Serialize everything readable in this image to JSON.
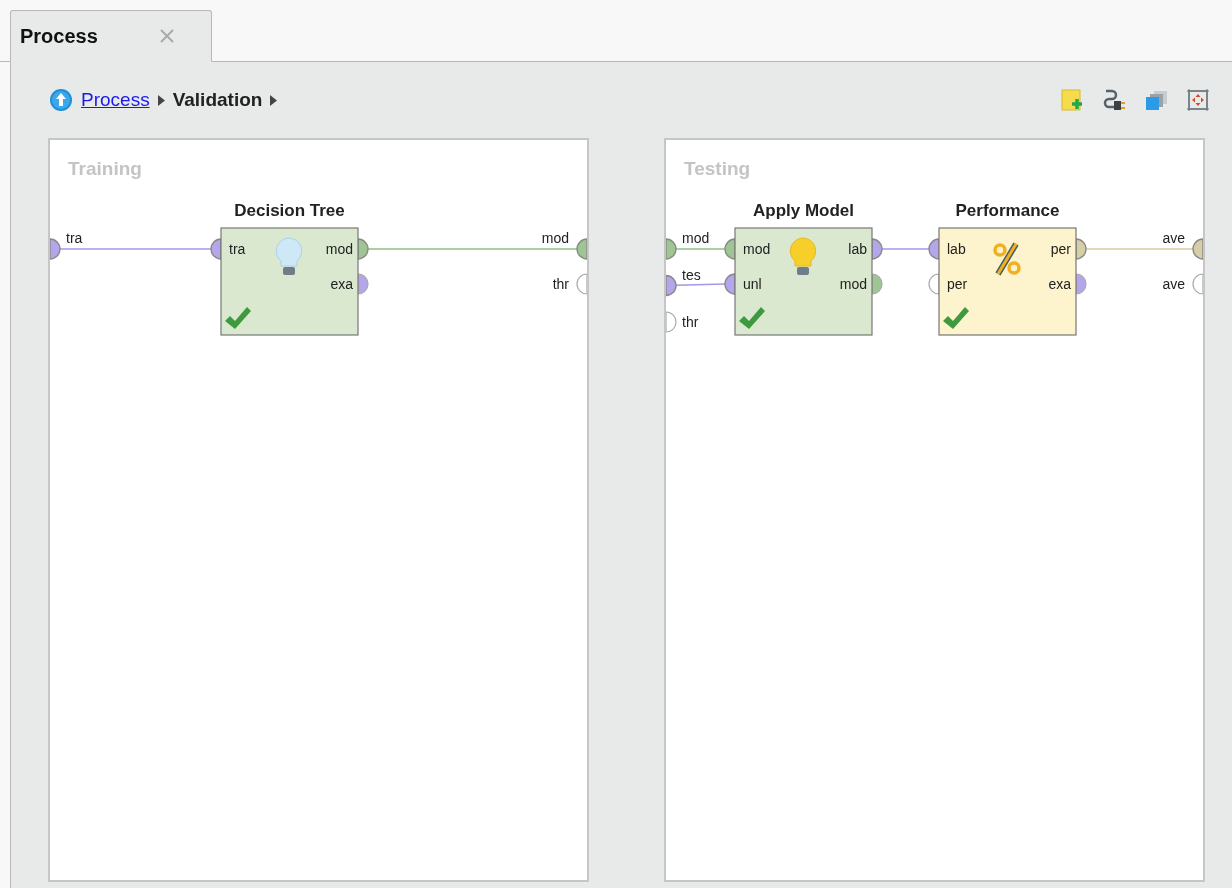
{
  "tab": {
    "label": "Process",
    "selected": true
  },
  "breadcrumb": [
    {
      "label": "Process",
      "kind": "link"
    },
    {
      "label": "Validation",
      "kind": "current"
    }
  ],
  "panels": [
    {
      "title": "Training",
      "inputs": [
        {
          "label": "tra",
          "color": "#b5a6ec",
          "connected": true
        }
      ],
      "outputs": [
        {
          "label": "mod",
          "color": "#9fc592",
          "connected": true
        },
        {
          "label": "thr",
          "color": "#ffffff",
          "connected": false
        }
      ],
      "operators": [
        {
          "name": "Decision Tree",
          "kind": "learner",
          "color": "#d9e8cf",
          "valid": true,
          "inputs": [
            {
              "label": "tra",
              "color": "#b5a6ec",
              "connected": true
            }
          ],
          "outputs": [
            {
              "label": "mod",
              "color": "#9fc592",
              "connected": true
            },
            {
              "label": "exa",
              "color": "#b5a6ec",
              "connected": false
            }
          ]
        }
      ]
    },
    {
      "title": "Testing",
      "inputs": [
        {
          "label": "mod",
          "color": "#9fc592",
          "connected": true
        },
        {
          "label": "tes",
          "color": "#b5a6ec",
          "connected": true
        },
        {
          "label": "thr",
          "color": "#ffffff",
          "connected": false
        }
      ],
      "outputs": [
        {
          "label": "ave",
          "color": "#d6cfa6",
          "connected": true
        },
        {
          "label": "ave",
          "color": "#ffffff",
          "connected": false
        }
      ],
      "operators": [
        {
          "name": "Apply Model",
          "kind": "applier",
          "color": "#d9e8cf",
          "valid": true,
          "inputs": [
            {
              "label": "mod",
              "color": "#9fc592",
              "connected": true
            },
            {
              "label": "unl",
              "color": "#b5a6ec",
              "connected": true
            }
          ],
          "outputs": [
            {
              "label": "lab",
              "color": "#b5a6ec",
              "connected": true
            },
            {
              "label": "mod",
              "color": "#9fc592",
              "connected": false
            }
          ]
        },
        {
          "name": "Performance",
          "kind": "performance",
          "color": "#fdf3cc",
          "valid": true,
          "inputs": [
            {
              "label": "lab",
              "color": "#b5a6ec",
              "connected": true
            },
            {
              "label": "per",
              "color": "#ffffff",
              "connected": false
            }
          ],
          "outputs": [
            {
              "label": "per",
              "color": "#d6cfa6",
              "connected": true
            },
            {
              "label": "exa",
              "color": "#b5a6ec",
              "connected": false
            }
          ]
        }
      ]
    }
  ]
}
